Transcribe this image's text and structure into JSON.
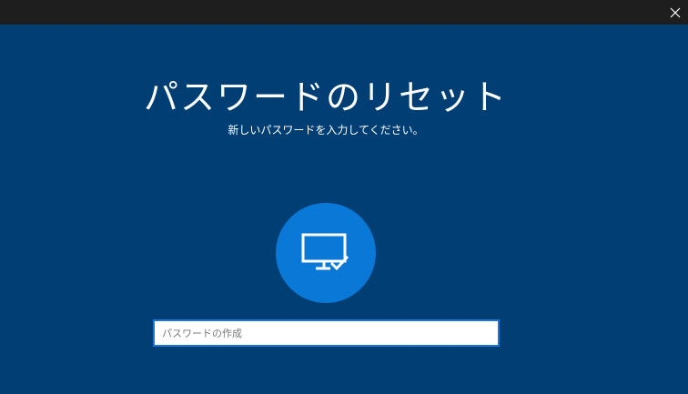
{
  "window": {
    "close_label": "×"
  },
  "reset": {
    "title": "パスワードのリセット",
    "subtitle": "新しいパスワードを入力してください。",
    "icon": "monitor-check-icon"
  },
  "password_field": {
    "placeholder": "パスワードの作成",
    "value": ""
  },
  "colors": {
    "background": "#003e73",
    "titlebar": "#1e1e1e",
    "avatar": "#0a78d7",
    "input_border": "#1a78d4"
  }
}
